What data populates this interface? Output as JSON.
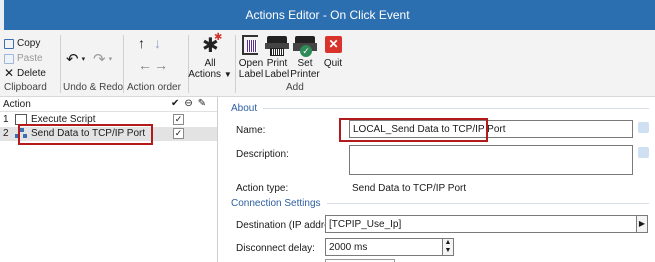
{
  "window": {
    "title": "Actions Editor - On Click Event"
  },
  "ribbon": {
    "clipboard": {
      "copy": "Copy",
      "paste": "Paste",
      "delete": "Delete",
      "group_label": "Clipboard"
    },
    "undo_redo": {
      "undo_glyph": "↶",
      "redo_glyph": "↷",
      "group_label": "Undo & Redo"
    },
    "action_order": {
      "group_label": "Action order"
    },
    "all_actions": {
      "line1": "All",
      "line2": "Actions"
    },
    "add": {
      "open_label": {
        "line1": "Open",
        "line2": "Label"
      },
      "print_label": {
        "line1": "Print",
        "line2": "Label"
      },
      "set_printer": {
        "line1": "Set",
        "line2": "Printer"
      },
      "quit": "Quit",
      "group_label": "Add"
    }
  },
  "action_list": {
    "header": "Action",
    "rows": [
      {
        "number": "1",
        "label": "Execute Script",
        "checked": "✓"
      },
      {
        "number": "2",
        "label": "Send Data to TCP/IP Port",
        "checked": "✓"
      }
    ]
  },
  "properties": {
    "about": {
      "title": "About",
      "name_label": "Name:",
      "name_value": "LOCAL_Send Data to TCP/IP Port",
      "description_label": "Description:",
      "description_value": "",
      "action_type_label": "Action type:",
      "action_type_value": "Send Data to TCP/IP Port"
    },
    "connection": {
      "title": "Connection Settings",
      "destination_label": "Destination (IP address:port):",
      "destination_value": "[TCPIP_Use_Ip]",
      "disconnect_label": "Disconnect delay:",
      "disconnect_value": "2000 ms"
    }
  },
  "colors": {
    "titlebar": "#2c6fb0",
    "highlight": "#b31b1b",
    "section": "#2c5fa0"
  }
}
